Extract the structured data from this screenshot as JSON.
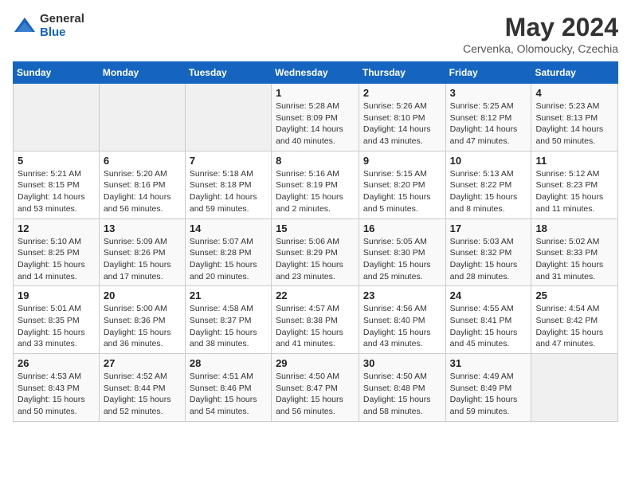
{
  "header": {
    "logo_general": "General",
    "logo_blue": "Blue",
    "month_title": "May 2024",
    "subtitle": "Cervenka, Olomoucky, Czechia"
  },
  "weekdays": [
    "Sunday",
    "Monday",
    "Tuesday",
    "Wednesday",
    "Thursday",
    "Friday",
    "Saturday"
  ],
  "weeks": [
    [
      {
        "day": "",
        "info": ""
      },
      {
        "day": "",
        "info": ""
      },
      {
        "day": "",
        "info": ""
      },
      {
        "day": "1",
        "info": "Sunrise: 5:28 AM\nSunset: 8:09 PM\nDaylight: 14 hours\nand 40 minutes."
      },
      {
        "day": "2",
        "info": "Sunrise: 5:26 AM\nSunset: 8:10 PM\nDaylight: 14 hours\nand 43 minutes."
      },
      {
        "day": "3",
        "info": "Sunrise: 5:25 AM\nSunset: 8:12 PM\nDaylight: 14 hours\nand 47 minutes."
      },
      {
        "day": "4",
        "info": "Sunrise: 5:23 AM\nSunset: 8:13 PM\nDaylight: 14 hours\nand 50 minutes."
      }
    ],
    [
      {
        "day": "5",
        "info": "Sunrise: 5:21 AM\nSunset: 8:15 PM\nDaylight: 14 hours\nand 53 minutes."
      },
      {
        "day": "6",
        "info": "Sunrise: 5:20 AM\nSunset: 8:16 PM\nDaylight: 14 hours\nand 56 minutes."
      },
      {
        "day": "7",
        "info": "Sunrise: 5:18 AM\nSunset: 8:18 PM\nDaylight: 14 hours\nand 59 minutes."
      },
      {
        "day": "8",
        "info": "Sunrise: 5:16 AM\nSunset: 8:19 PM\nDaylight: 15 hours\nand 2 minutes."
      },
      {
        "day": "9",
        "info": "Sunrise: 5:15 AM\nSunset: 8:20 PM\nDaylight: 15 hours\nand 5 minutes."
      },
      {
        "day": "10",
        "info": "Sunrise: 5:13 AM\nSunset: 8:22 PM\nDaylight: 15 hours\nand 8 minutes."
      },
      {
        "day": "11",
        "info": "Sunrise: 5:12 AM\nSunset: 8:23 PM\nDaylight: 15 hours\nand 11 minutes."
      }
    ],
    [
      {
        "day": "12",
        "info": "Sunrise: 5:10 AM\nSunset: 8:25 PM\nDaylight: 15 hours\nand 14 minutes."
      },
      {
        "day": "13",
        "info": "Sunrise: 5:09 AM\nSunset: 8:26 PM\nDaylight: 15 hours\nand 17 minutes."
      },
      {
        "day": "14",
        "info": "Sunrise: 5:07 AM\nSunset: 8:28 PM\nDaylight: 15 hours\nand 20 minutes."
      },
      {
        "day": "15",
        "info": "Sunrise: 5:06 AM\nSunset: 8:29 PM\nDaylight: 15 hours\nand 23 minutes."
      },
      {
        "day": "16",
        "info": "Sunrise: 5:05 AM\nSunset: 8:30 PM\nDaylight: 15 hours\nand 25 minutes."
      },
      {
        "day": "17",
        "info": "Sunrise: 5:03 AM\nSunset: 8:32 PM\nDaylight: 15 hours\nand 28 minutes."
      },
      {
        "day": "18",
        "info": "Sunrise: 5:02 AM\nSunset: 8:33 PM\nDaylight: 15 hours\nand 31 minutes."
      }
    ],
    [
      {
        "day": "19",
        "info": "Sunrise: 5:01 AM\nSunset: 8:35 PM\nDaylight: 15 hours\nand 33 minutes."
      },
      {
        "day": "20",
        "info": "Sunrise: 5:00 AM\nSunset: 8:36 PM\nDaylight: 15 hours\nand 36 minutes."
      },
      {
        "day": "21",
        "info": "Sunrise: 4:58 AM\nSunset: 8:37 PM\nDaylight: 15 hours\nand 38 minutes."
      },
      {
        "day": "22",
        "info": "Sunrise: 4:57 AM\nSunset: 8:38 PM\nDaylight: 15 hours\nand 41 minutes."
      },
      {
        "day": "23",
        "info": "Sunrise: 4:56 AM\nSunset: 8:40 PM\nDaylight: 15 hours\nand 43 minutes."
      },
      {
        "day": "24",
        "info": "Sunrise: 4:55 AM\nSunset: 8:41 PM\nDaylight: 15 hours\nand 45 minutes."
      },
      {
        "day": "25",
        "info": "Sunrise: 4:54 AM\nSunset: 8:42 PM\nDaylight: 15 hours\nand 47 minutes."
      }
    ],
    [
      {
        "day": "26",
        "info": "Sunrise: 4:53 AM\nSunset: 8:43 PM\nDaylight: 15 hours\nand 50 minutes."
      },
      {
        "day": "27",
        "info": "Sunrise: 4:52 AM\nSunset: 8:44 PM\nDaylight: 15 hours\nand 52 minutes."
      },
      {
        "day": "28",
        "info": "Sunrise: 4:51 AM\nSunset: 8:46 PM\nDaylight: 15 hours\nand 54 minutes."
      },
      {
        "day": "29",
        "info": "Sunrise: 4:50 AM\nSunset: 8:47 PM\nDaylight: 15 hours\nand 56 minutes."
      },
      {
        "day": "30",
        "info": "Sunrise: 4:50 AM\nSunset: 8:48 PM\nDaylight: 15 hours\nand 58 minutes."
      },
      {
        "day": "31",
        "info": "Sunrise: 4:49 AM\nSunset: 8:49 PM\nDaylight: 15 hours\nand 59 minutes."
      },
      {
        "day": "",
        "info": ""
      }
    ]
  ]
}
